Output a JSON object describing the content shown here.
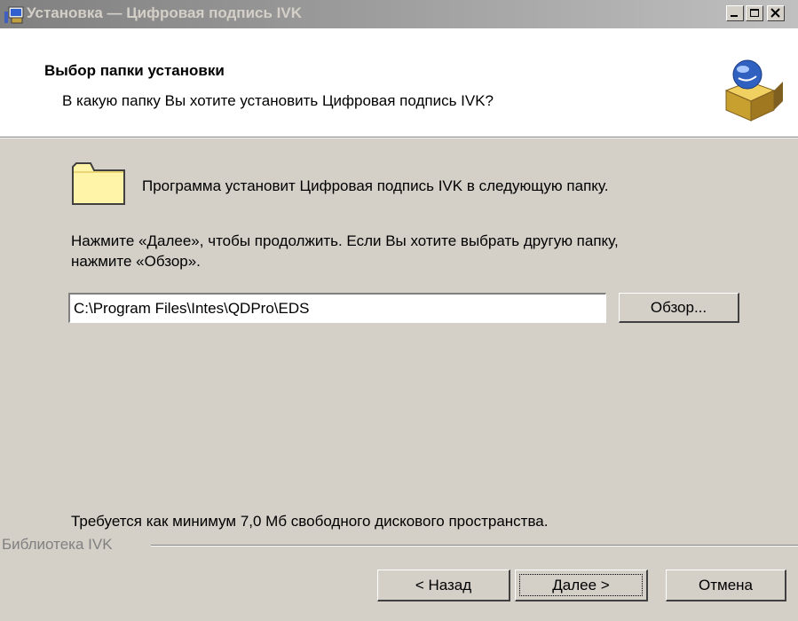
{
  "window": {
    "title": "Установка — Цифровая подпись IVK",
    "controls": [
      "minimize-icon",
      "maximize-icon",
      "close-icon"
    ]
  },
  "header": {
    "title": "Выбор папки установки",
    "subtitle": "В какую папку Вы хотите установить Цифровая подпись IVK?",
    "icon": "setup-box-icon"
  },
  "main": {
    "folder_icon": "folder-icon",
    "info_text": "Программа установит Цифровая подпись IVK в следующую папку.",
    "instruction_line1": "Нажмите «Далее», чтобы продолжить. Если Вы хотите выбрать другую папку,",
    "instruction_line2": "нажмите «Обзор».",
    "path_value": "C:\\Program Files\\Intes\\QDPro\\EDS",
    "browse_label": "Обзор...",
    "disk_space_text": "Требуется как минимум 7,0 Мб свободного дискового пространства."
  },
  "footer": {
    "brand": "Библиотека IVK",
    "back_label": "< Назад",
    "next_label": "Далее >",
    "cancel_label": "Отмена"
  },
  "colors": {
    "dialog_bg": "#d4d0c8",
    "titlebar_start": "#808080",
    "titlebar_end": "#c0c0c0",
    "folder_fill": "#fff4a8"
  }
}
